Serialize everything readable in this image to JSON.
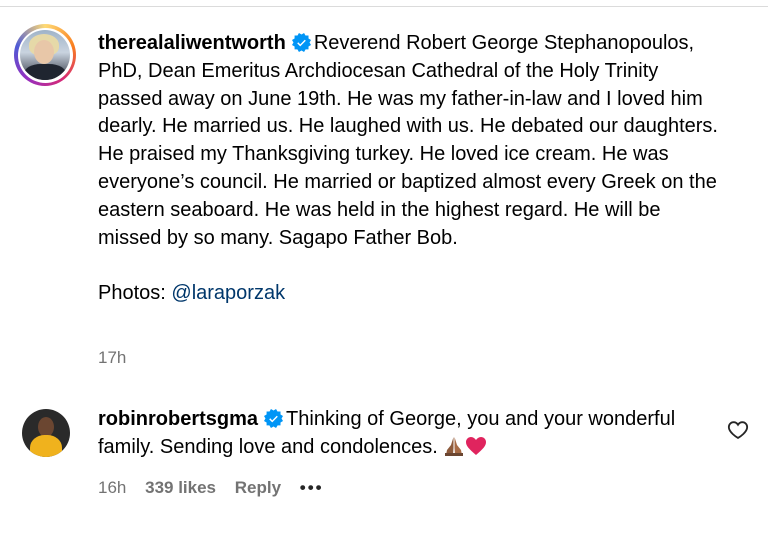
{
  "caption": {
    "username": "therealaliwentworth",
    "text": "Reverend Robert George Stephanopoulos, PhD, Dean Emeritus Archdiocesan Cathedral of the Holy Trinity passed away on June 19th. He was my father-in-law and I loved him dearly. He married us. He laughed with us. He debated our daughters. He praised my Thanksgiving turkey. He loved ice cream. He was everyone’s council. He married or baptized almost every Greek on the eastern seaboard. He was held in the highest regard. He will be missed by so many. Sagapo Father Bob.",
    "photos_label": "Photos:",
    "photos_mention": "@laraporzak",
    "time": "17h"
  },
  "comments": [
    {
      "username": "robinrobertsgma",
      "text": "Thinking of George, you and your wonderful family. Sending love and condolences.",
      "emojis": [
        "folded-hands-icon",
        "red-heart-icon"
      ],
      "time": "16h",
      "likes": "339 likes",
      "reply_label": "Reply",
      "more_label": "•••"
    }
  ],
  "colors": {
    "text": "#000000",
    "muted": "#737373",
    "mention": "#00376b",
    "verified": "#0095f6",
    "heart": "#e0245e"
  }
}
